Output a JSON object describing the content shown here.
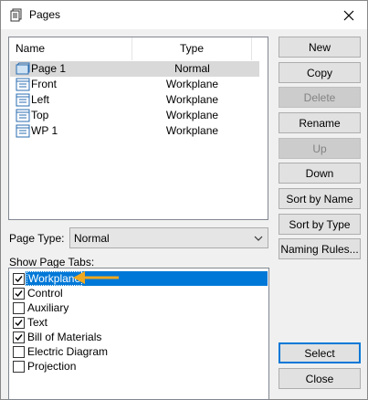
{
  "window": {
    "title": "Pages"
  },
  "list": {
    "columns": [
      "Name",
      "Type"
    ],
    "rows": [
      {
        "name": "Page 1",
        "type": "Normal",
        "icon": "page-icon"
      },
      {
        "name": "Front",
        "type": "Workplane",
        "icon": "workplane-icon"
      },
      {
        "name": "Left",
        "type": "Workplane",
        "icon": "workplane-icon"
      },
      {
        "name": "Top",
        "type": "Workplane",
        "icon": "workplane-icon"
      },
      {
        "name": "WP 1",
        "type": "Workplane",
        "icon": "workplane-icon"
      }
    ]
  },
  "buttons": {
    "new": "New",
    "copy": "Copy",
    "delete": "Delete",
    "rename": "Rename",
    "up": "Up",
    "down": "Down",
    "sort_by_name": "Sort by Name",
    "sort_by_type": "Sort by Type",
    "naming_rules": "Naming Rules...",
    "select": "Select",
    "close": "Close"
  },
  "page_type": {
    "label": "Page Type:",
    "value": "Normal"
  },
  "show_tabs": {
    "label": "Show Page Tabs:",
    "items": [
      {
        "label": "Workplane",
        "checked": true
      },
      {
        "label": "Control",
        "checked": true
      },
      {
        "label": "Auxiliary",
        "checked": false
      },
      {
        "label": "Text",
        "checked": true
      },
      {
        "label": "Bill of Materials",
        "checked": true
      },
      {
        "label": "Electric Diagram",
        "checked": false
      },
      {
        "label": "Projection",
        "checked": false
      }
    ]
  },
  "colors": {
    "accent": "#0078d7",
    "annotation_arrow": "#f0a81e"
  }
}
